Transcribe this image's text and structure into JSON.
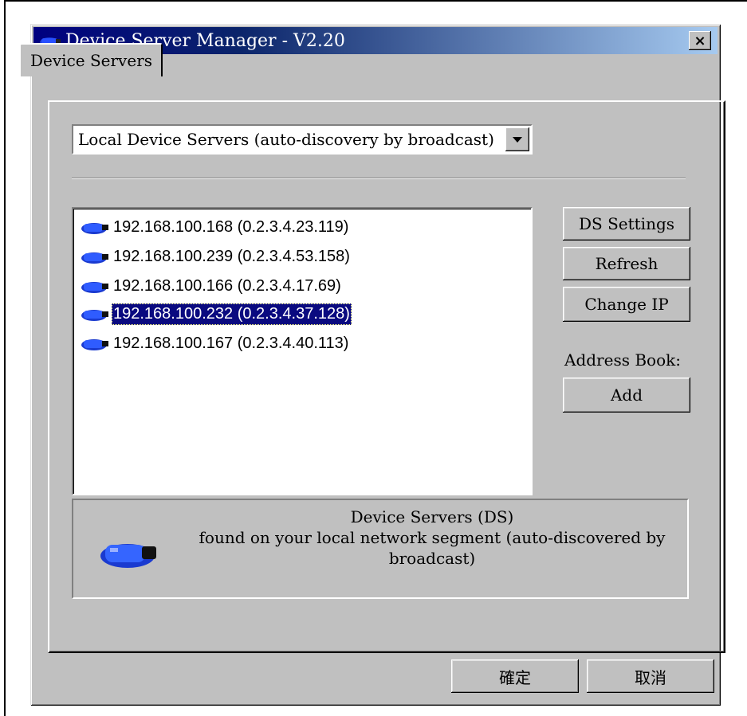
{
  "window": {
    "title": "Device Server Manager - V2.20",
    "close_label": "×"
  },
  "tabs": [
    {
      "label": "Device Servers",
      "active": true
    }
  ],
  "discovery_select": {
    "value": "Local Device Servers (auto-discovery by broadcast)"
  },
  "server_list": {
    "items": [
      {
        "label": "192.168.100.168 (0.2.3.4.23.119)",
        "selected": false
      },
      {
        "label": "192.168.100.239 (0.2.3.4.53.158)",
        "selected": false
      },
      {
        "label": "192.168.100.166 (0.2.3.4.17.69)",
        "selected": false
      },
      {
        "label": "192.168.100.232 (0.2.3.4.37.128)",
        "selected": true
      },
      {
        "label": "192.168.100.167 (0.2.3.4.40.113)",
        "selected": false
      }
    ]
  },
  "side_panel": {
    "ds_settings_label": "DS Settings",
    "refresh_label": "Refresh",
    "change_ip_label": "Change IP",
    "address_book_label": "Address Book:",
    "add_label": "Add"
  },
  "info": {
    "line1": "Device Servers (DS)",
    "line2": "found on your local network segment (auto-discovered by",
    "line3": "broadcast)"
  },
  "footer": {
    "ok_label": "確定",
    "cancel_label": "取消"
  },
  "colors": {
    "selection": "#0a0a80",
    "titlebar": "#000080",
    "device_icon": "#1a3ad0"
  },
  "icons": {
    "app": "device-server-icon",
    "list_item": "device-server-icon",
    "info": "device-server-icon",
    "close": "close-icon",
    "dropdown": "chevron-down-icon"
  }
}
